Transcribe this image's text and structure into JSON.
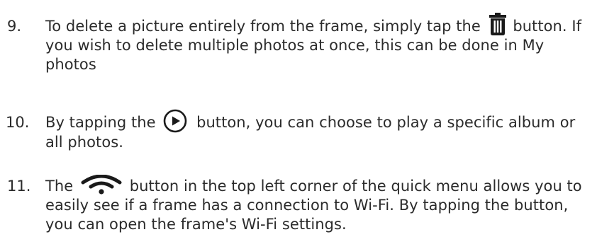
{
  "items": [
    {
      "number": "9.",
      "before_icon": "To delete a picture entirely from the frame, simply tap the",
      "icon": "trash-icon",
      "after_icon": "button. If you wish to delete multiple photos at once, this can be done in My photos"
    },
    {
      "number": "10.",
      "before_icon": "By tapping the",
      "icon": "play-circle-icon",
      "after_icon": "button, you can choose to play a specific album or all photos."
    },
    {
      "number": "11.",
      "before_icon": "The",
      "icon": "wifi-icon",
      "after_icon": "button in the top left corner of the quick menu allows you to easily see if a frame has a connection to Wi-Fi. By tapping the button, you can open the frame's Wi-Fi settings."
    }
  ],
  "colors": {
    "text": "#2b2b2b",
    "icon": "#1a1a1a"
  }
}
